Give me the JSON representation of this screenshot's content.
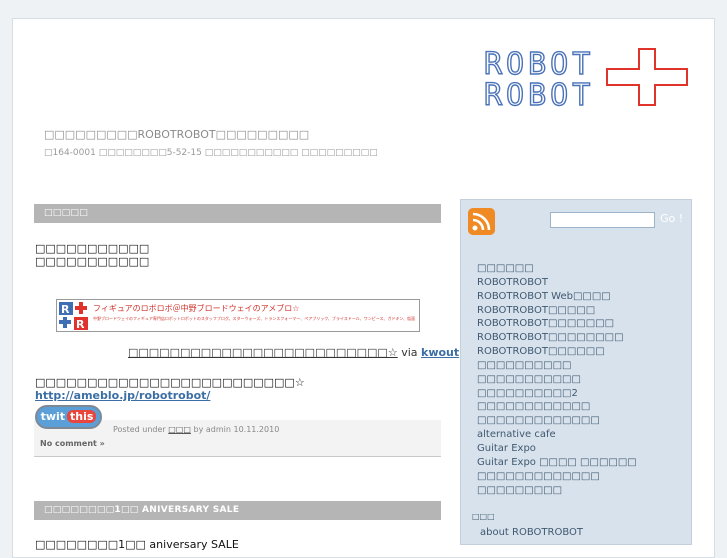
{
  "site": {
    "title": "□□□□□□□□□ROBOTROBOT□□□□□□□□□",
    "address": "□164-0001 □□□□□□□□5-52-15 □□□□□□□□□□□ □□□□□□□□□"
  },
  "logo": {
    "line1": "ROBOT",
    "line2": "ROBOT",
    "accent": "#e0332c",
    "text_color": "#4a72b8"
  },
  "post1": {
    "header": "□□□□□",
    "body_lines": [
      "□□□□□□□□□□□",
      "□□□□□□□□□□□"
    ],
    "banner": {
      "logo": "R+",
      "title": "フィギュアのロボロボ＠中野ブロードウェイのアメブロ☆",
      "subtitle": "中野ブロードウェイのフィギュア専門店ロボットロボットのスタッフブログ。スターウォーズ、トランスフォーマー、ペアブリック、ブライスドール、ワンピース、ガドキン、仮面ライダーの人形情報など、商品を紹介。"
    },
    "kwout_link": "□□□□□□□□□□□□□□□□□□□□□□□□□☆",
    "kwout_via": "via",
    "kwout_brand": "kwout",
    "hint": "□□□□□□□□□□□□□□□□□□□□□□□□□☆",
    "link": "http://ameblo.jp/robotrobot/",
    "tweet_button": {
      "left": "twit",
      "right": "this"
    },
    "meta": {
      "posted_under": "Posted under",
      "category": "□□□",
      "by": "by",
      "author": "admin",
      "date": "10.11.2010"
    },
    "no_comment": "No comment »"
  },
  "post2": {
    "header": "□□□□□□□□1□□ ANIVERSARY SALE",
    "first_line": "□□□□□□□□1□□ aniversary SALE"
  },
  "sidebar": {
    "search_go": "Go !",
    "search_value": "",
    "categories": [
      "□□□□□□",
      "ROBOTROBOT",
      "ROBOTROBOT Web□□□□",
      "ROBOTROBOT□□□□□",
      "ROBOTROBOT□□□□□□□",
      "ROBOTROBOT□□□□□□□□",
      "ROBOTROBOT□□□□□□",
      "□□□□□□□□□□",
      "□□□□□□□□□□□",
      "□□□□□□□□□□2",
      "□□□□□□□□□□□□",
      "□□□□□□□□□□□□□",
      "alternative cafe",
      "Guitar Expo",
      "Guitar Expo □□□□ □□□□□□",
      "□□□□□□□□□□□□□",
      "□□□□□□□□□"
    ],
    "section_label": "□□□",
    "about": "about ROBOTROBOT"
  }
}
